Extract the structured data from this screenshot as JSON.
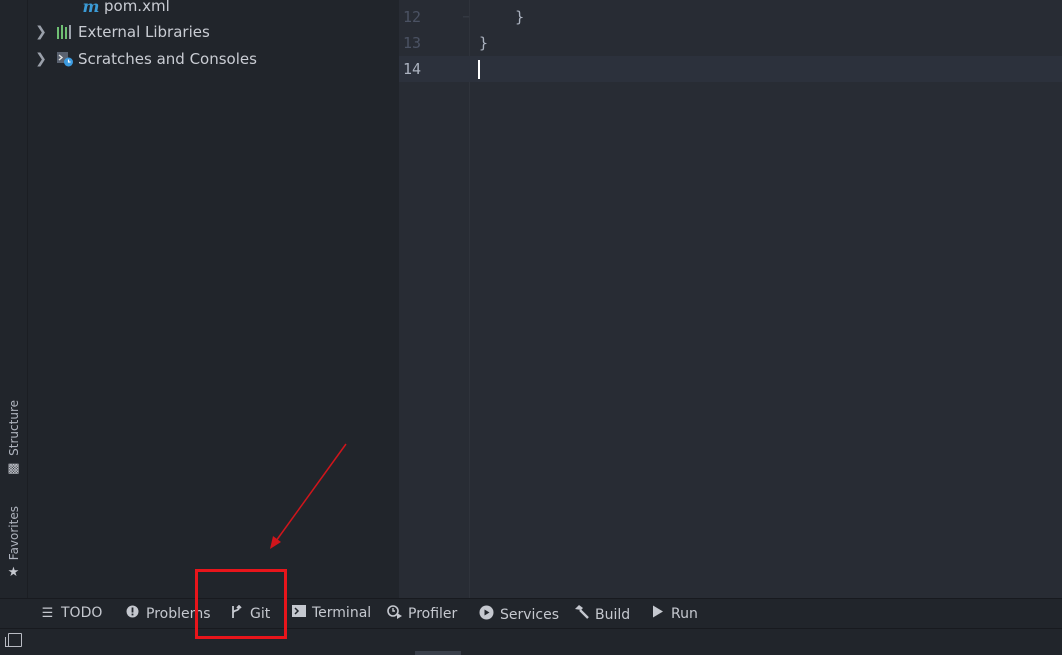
{
  "left_strip": {
    "structure_label": "Structure",
    "favorites_label": "Favorites"
  },
  "project_tree": {
    "items": [
      {
        "label": "pom.xml",
        "icon": "maven-file-icon"
      },
      {
        "label": "External Libraries",
        "icon": "libraries-icon"
      },
      {
        "label": "Scratches and Consoles",
        "icon": "scratches-icon"
      }
    ]
  },
  "editor": {
    "lines": [
      {
        "number": "12",
        "code": "    }"
      },
      {
        "number": "13",
        "code": "}"
      },
      {
        "number": "14",
        "code": ""
      }
    ],
    "current_line": "14"
  },
  "bottom_toolbar": {
    "items": [
      {
        "label": "TODO",
        "icon": "list-icon"
      },
      {
        "label": "Problems",
        "icon": "warning-circle-icon"
      },
      {
        "label": "Git",
        "icon": "git-branch-icon"
      },
      {
        "label": "Terminal",
        "icon": "terminal-icon"
      },
      {
        "label": "Profiler",
        "icon": "profiler-icon"
      },
      {
        "label": "Services",
        "icon": "services-icon"
      },
      {
        "label": "Build",
        "icon": "hammer-icon"
      },
      {
        "label": "Run",
        "icon": "play-icon"
      }
    ]
  },
  "annotation": {
    "color": "#e8151b",
    "target": "Git"
  },
  "colors": {
    "panel_bg": "#21252b",
    "editor_bg": "#282c34",
    "maven_blue": "#3b9bd6",
    "libraries_green": "#6fbf73"
  }
}
